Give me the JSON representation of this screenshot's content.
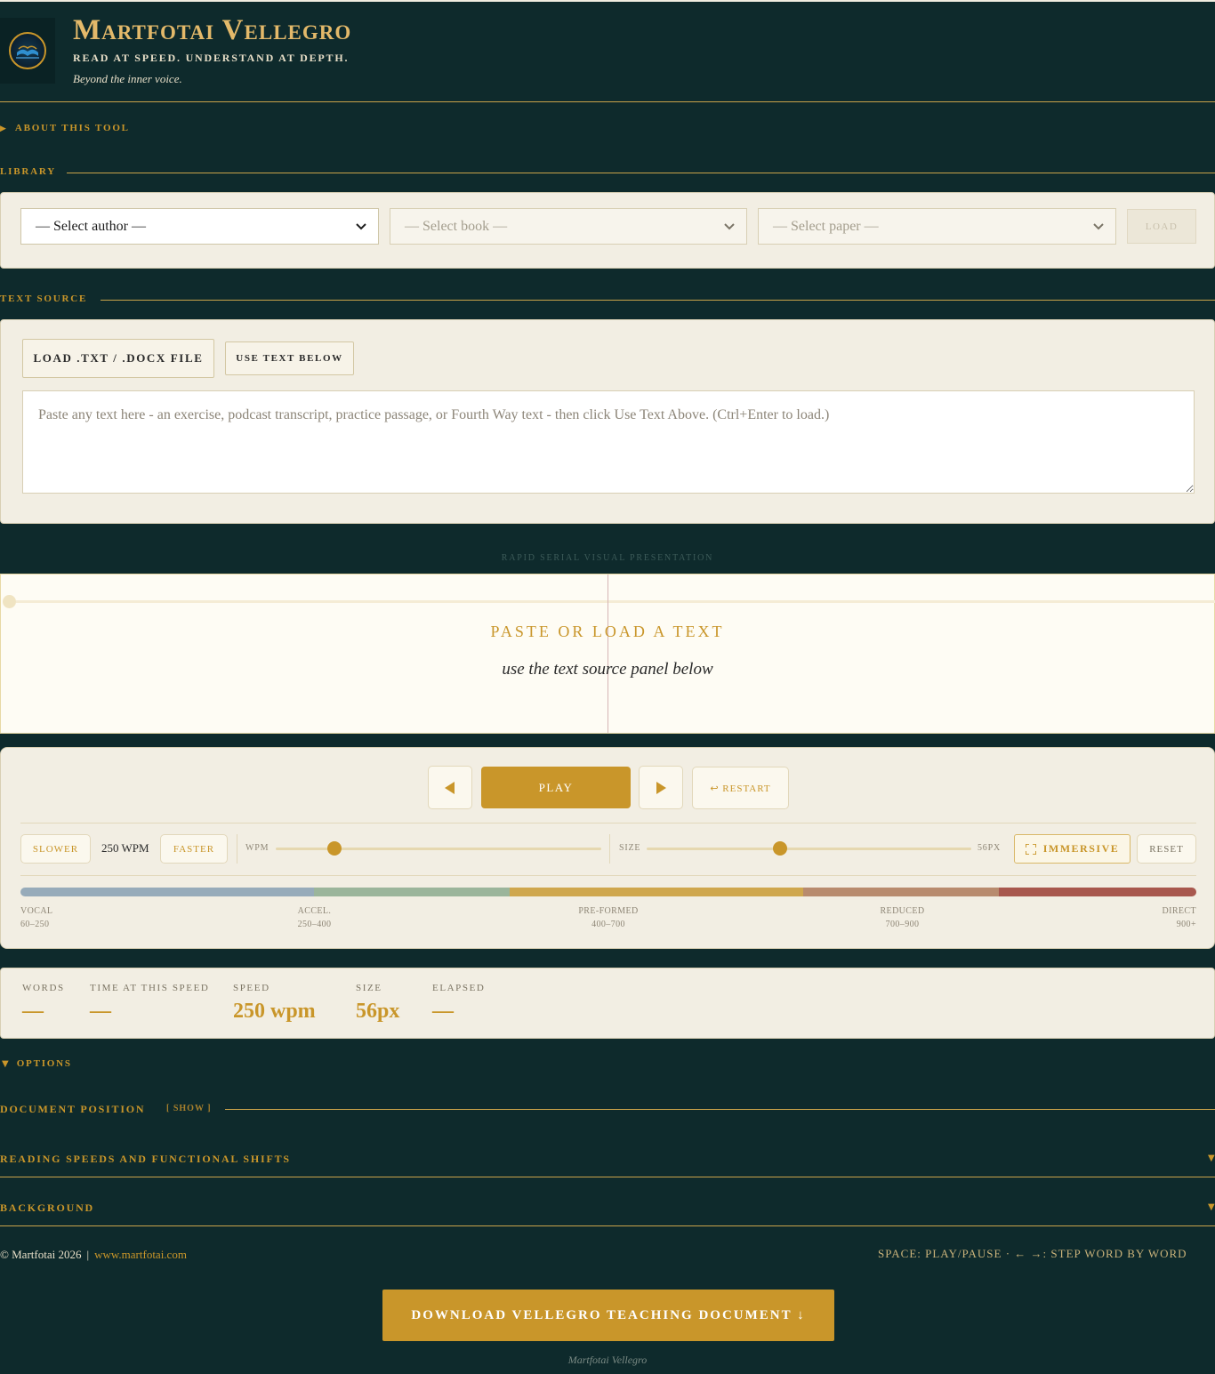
{
  "header": {
    "title": "Martfotai Vellegro",
    "tagline": "READ AT SPEED. UNDERSTAND AT DEPTH.",
    "subtitle": "Beyond the inner voice.",
    "logo_icon": "open-book-wings-icon"
  },
  "about": {
    "label": "ABOUT THIS TOOL",
    "icon": "triangle-right-icon"
  },
  "library": {
    "heading": "LIBRARY",
    "author_select": "— Select author —",
    "book_select": "— Select book —",
    "paper_select": "— Select paper —",
    "load_button": "LOAD"
  },
  "text_source": {
    "heading": "TEXT SOURCE",
    "file_button": "LOAD .TXT / .DOCX FILE",
    "use_button": "USE TEXT BELOW",
    "placeholder": "Paste any text here - an exercise, podcast transcript, practice passage, or Fourth Way text - then click Use Text Above. (Ctrl+Enter to load.)"
  },
  "rsvp": {
    "label": "RAPID SERIAL VISUAL PRESENTATION",
    "prompt": "PASTE OR LOAD A TEXT",
    "hint": "use the text source panel below"
  },
  "controls": {
    "prev_icon": "triangle-left-icon",
    "play_label": "PLAY",
    "next_icon": "triangle-right-icon",
    "restart_label": "↩ RESTART",
    "slower_label": "SLOWER",
    "wpm_value": "250 WPM",
    "faster_label": "FASTER",
    "wpm_slider_label": "WPM",
    "wpm_slider_fraction": 0.18,
    "size_slider_label": "SIZE",
    "size_slider_fraction": 0.41,
    "size_value": "56PX",
    "immersive_label": "IMMERSIVE",
    "reset_label": "RESET"
  },
  "speed_zones": [
    {
      "name": "VOCAL",
      "range": "60–250",
      "color": "#97abba"
    },
    {
      "name": "ACCEL.",
      "range": "250–400",
      "color": "#9bb59b"
    },
    {
      "name": "PRE-FORMED",
      "range": "400–700",
      "color": "#cfa74e"
    },
    {
      "name": "REDUCED",
      "range": "700–900",
      "color": "#b88b6e"
    },
    {
      "name": "DIRECT",
      "range": "900+",
      "color": "#a8584e"
    }
  ],
  "stats": {
    "words_label": "WORDS",
    "words_value": "—",
    "time_label": "TIME AT THIS SPEED",
    "time_value": "—",
    "speed_label": "SPEED",
    "speed_value": "250 wpm",
    "size_label": "SIZE",
    "size_value": "56px",
    "elapsed_label": "ELAPSED",
    "elapsed_value": "—"
  },
  "options": {
    "label": "OPTIONS",
    "icon": "triangle-down-icon"
  },
  "doc_position": {
    "heading": "DOCUMENT POSITION",
    "toggle": "[ SHOW ]"
  },
  "sections": [
    {
      "label": "READING SPEEDS AND FUNCTIONAL SHIFTS"
    },
    {
      "label": "BACKGROUND"
    }
  ],
  "footer": {
    "copyright": "© Martfotai 2026",
    "separator": "|",
    "link": "www.martfotai.com",
    "shortcuts": "SPACE: PLAY/PAUSE · ← →: STEP WORD BY WORD",
    "download_label": "DOWNLOAD VELLEGRO TEACHING DOCUMENT ↓",
    "signature": "Martfotai Vellegro"
  },
  "colors": {
    "background": "#0e2a2c",
    "accent_gold": "#c9962a",
    "panel_cream": "#f2eee3"
  }
}
